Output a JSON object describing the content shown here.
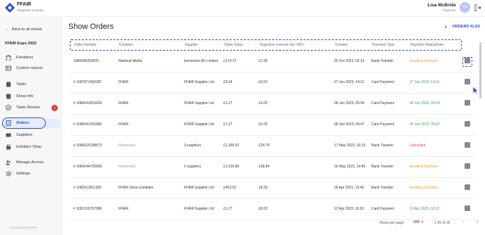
{
  "topbar": {
    "brand": "FFAIR",
    "brand_sub": "Organiser Console",
    "user_name": "Lisa McBride",
    "user_role": "Organiser",
    "avatar_initials": "LM"
  },
  "sidebar": {
    "back": "Back to all shows",
    "event_title": "FFAIR Expo 2022",
    "items": [
      {
        "label": "Exhibitors",
        "icon": "building-icon"
      },
      {
        "label": "Custom reports",
        "icon": "table-icon"
      },
      {
        "label": "Tasks",
        "icon": "book-icon"
      },
      {
        "label": "Show Info",
        "icon": "info-book-icon"
      },
      {
        "label": "Tasks Review",
        "icon": "check-circle-icon",
        "badge": "7"
      },
      {
        "label": "Orders",
        "icon": "orders-icon",
        "active": true
      },
      {
        "label": "Suppliers",
        "icon": "suppliers-icon"
      },
      {
        "label": "Exhibitor Shop",
        "icon": "shop-icon"
      },
      {
        "label": "Manage Access",
        "icon": "users-icon"
      },
      {
        "label": "Settings",
        "icon": "gear-icon"
      }
    ],
    "powered_by": "Powered by  FFAIR"
  },
  "main": {
    "title": "Show Orders",
    "export_label": "ORDERS XLSX",
    "columns": [
      "Order Number",
      "Exhibitor",
      "Supplier",
      "Order Value",
      "Organiser revenue (inc VAT)",
      "Created",
      "Payment Type",
      "Payment Status/Date"
    ],
    "rows": [
      {
        "order": "1686095255832",
        "exhibitor": "National Media",
        "supplier": "Immersive AV Limited",
        "value": "£174.72",
        "revenue": "£1.56",
        "created": "03 Oct 2023, 03:14",
        "ptype": "Bank Transfer",
        "status": "Awaiting Payment",
        "status_color": "orange"
      },
      {
        "order": "# 1687871492287",
        "exhibitor": "FFAIR",
        "supplier": "FFAIR Supplier Ltd",
        "value": "£0.64",
        "revenue": "£0.01",
        "created": "27 Jun 2023, 14:11",
        "ptype": "Card Payment",
        "status": "27 Jun 2023, 14:11",
        "status_color": "green"
      },
      {
        "order": "# 1686041653426",
        "exhibitor": "FFAIR",
        "supplier": "FFAIR Supplier Ltd",
        "value": "£1.27",
        "revenue": "£0.02",
        "created": "06 Jun 2023, 09:54",
        "ptype": "Card Payment",
        "status": "06 Jun 2023, 09:54",
        "status_color": "green"
      },
      {
        "order": "# 1686041252685",
        "exhibitor": "FFAIR",
        "supplier": "FFAIR Supplier Ltd",
        "value": "£1.27",
        "revenue": "£0.02",
        "created": "06 Jun 2023, 09:47",
        "ptype": "Card Payment",
        "status": "06 Jun 2023, 09:47",
        "status_color": "green"
      },
      {
        "order": "# 1684315198673",
        "exhibitor": "Removed",
        "exhibitor_muted": true,
        "supplier": "3 suppliers",
        "value": "£1,300.02",
        "revenue": "£24.70",
        "created": "17 May 2023, 10:19",
        "ptype": "Bank Transfer",
        "status": "Cancelled",
        "status_color": "red"
      },
      {
        "order": "# 1684244725609",
        "exhibitor": "Removed",
        "exhibitor_muted": true,
        "supplier": "2 suppliers",
        "value": "£1,516.80",
        "revenue": "£28.84",
        "created": "16 May 2023, 14:45",
        "ptype": "Bank Transfer",
        "status": "Awaiting Payment",
        "status_color": "orange"
      },
      {
        "order": "# 1682512811300",
        "exhibitor": "FFAIR Demo Exhibitor",
        "supplier": "FFAIR Supplier Ltd",
        "value": "£453.02",
        "revenue": "£8.55",
        "created": "26 Apr 2023, 13:40",
        "ptype": "Bank Transfer",
        "status": "Awaiting Payment",
        "status_color": "orange"
      },
      {
        "order": "# 1681316707086",
        "exhibitor": "FFAIR",
        "supplier": "FFAIR Supplier Ltd",
        "value": "£1.27",
        "revenue": "£0.02",
        "created": "12 Apr 2023, 16:01",
        "ptype": "Card Payment",
        "status": "12 Apr 2023, 16:22",
        "status_color": "green"
      }
    ],
    "pager": {
      "rows_per_page_label": "Rows per page:",
      "rows_per_page": "100",
      "range": "1-26 of 26"
    }
  },
  "colors": {
    "accent": "#2a4cc9",
    "orange": "#f29d2b",
    "green": "#3aa54a",
    "red": "#e23a3a"
  }
}
